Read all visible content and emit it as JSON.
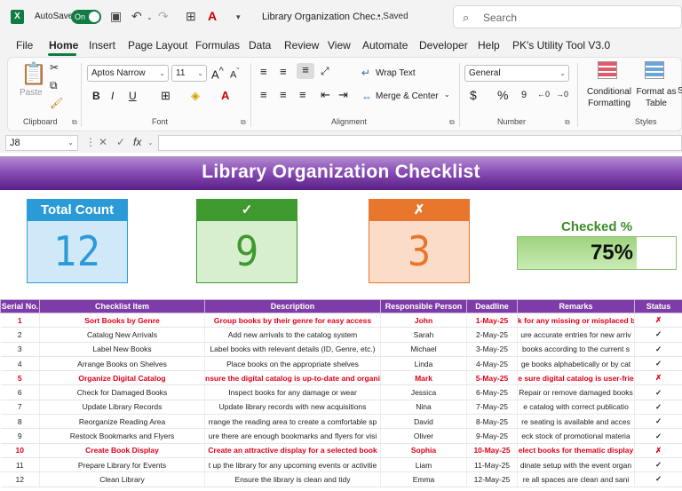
{
  "titlebar": {
    "autosave_label": "AutoSave",
    "toggle_label": "On",
    "doc_title": "Library Organization Chec...",
    "saved_label": "• Saved",
    "search_placeholder": "Search"
  },
  "menu": [
    "File",
    "Home",
    "Insert",
    "Page Layout",
    "Formulas",
    "Data",
    "Review",
    "View",
    "Automate",
    "Developer",
    "Help",
    "PK's Utility Tool V3.0"
  ],
  "ribbon": {
    "clipboard": {
      "paste": "Paste",
      "label": "Clipboard"
    },
    "font": {
      "name": "Aptos Narrow",
      "size": "11",
      "label": "Font",
      "bold": "B",
      "italic": "I",
      "underline": "U"
    },
    "alignment": {
      "wrap": "Wrap Text",
      "merge": "Merge & Center",
      "label": "Alignment"
    },
    "number": {
      "format": "General",
      "label": "Number",
      "currency": "$",
      "percent": "%"
    },
    "styles": {
      "conditional": "Conditional Formatting",
      "format_table": "Format as Table",
      "label": "Styles"
    }
  },
  "formula_bar": {
    "cell_ref": "J8",
    "fx": "fx",
    "value": ""
  },
  "sheet": {
    "title": "Library Organization Checklist",
    "cards": {
      "total": {
        "label": "Total Count",
        "value": "12",
        "color": "#2b9bd8"
      },
      "checked": {
        "label": "✓",
        "value": "9",
        "color": "#3e9a2e"
      },
      "crossed": {
        "label": "✗",
        "value": "3",
        "color": "#e8762c"
      }
    },
    "progress": {
      "label": "Checked %",
      "value_text": "75%",
      "fraction": 0.75
    },
    "columns": [
      "Serial No.",
      "Checklist Item",
      "Description",
      "Responsible Person",
      "Deadline",
      "Remarks",
      "Status"
    ],
    "rows": [
      {
        "no": "1",
        "item": "Sort Books by Genre",
        "desc": "Group books by their genre for easy access",
        "person": "John",
        "deadline": "1-May-25",
        "remarks": "k for any missing or misplaced b",
        "status": "✗",
        "flag": true
      },
      {
        "no": "2",
        "item": "Catalog New Arrivals",
        "desc": "Add new arrivals to the catalog system",
        "person": "Sarah",
        "deadline": "2-May-25",
        "remarks": "ure accurate entries for new arriv",
        "status": "✓",
        "flag": false
      },
      {
        "no": "3",
        "item": "Label New Books",
        "desc": "Label books with relevant details (ID, Genre, etc.)",
        "person": "Michael",
        "deadline": "3-May-25",
        "remarks": "books according to the current s",
        "status": "✓",
        "flag": false
      },
      {
        "no": "4",
        "item": "Arrange Books on Shelves",
        "desc": "Place books on the appropriate shelves",
        "person": "Linda",
        "deadline": "4-May-25",
        "remarks": "ge books alphabetically or by cat",
        "status": "✓",
        "flag": false
      },
      {
        "no": "5",
        "item": "Organize Digital Catalog",
        "desc": "nsure the digital catalog is up-to-date and organiz",
        "person": "Mark",
        "deadline": "5-May-25",
        "remarks": "e sure digital catalog is user-frie",
        "status": "✗",
        "flag": true
      },
      {
        "no": "6",
        "item": "Check for Damaged Books",
        "desc": "Inspect books for any damage or wear",
        "person": "Jessica",
        "deadline": "6-May-25",
        "remarks": "Repair or remove damaged books",
        "status": "✓",
        "flag": false
      },
      {
        "no": "7",
        "item": "Update Library Records",
        "desc": "Update library records with new acquisitions",
        "person": "Nina",
        "deadline": "7-May-25",
        "remarks": "e catalog with correct publicatio",
        "status": "✓",
        "flag": false
      },
      {
        "no": "8",
        "item": "Reorganize Reading Area",
        "desc": "rrange the reading area to create a comfortable sp",
        "person": "David",
        "deadline": "8-May-25",
        "remarks": "re seating is available and acces",
        "status": "✓",
        "flag": false
      },
      {
        "no": "9",
        "item": "Restock Bookmarks and Flyers",
        "desc": "ure there are enough bookmarks and flyers for visi",
        "person": "Oliver",
        "deadline": "9-May-25",
        "remarks": "eck stock of promotional materia",
        "status": "✓",
        "flag": false
      },
      {
        "no": "10",
        "item": "Create Book Display",
        "desc": "Create an attractive display for a selected book",
        "person": "Sophia",
        "deadline": "10-May-25",
        "remarks": "elect books for thematic display",
        "status": "✗",
        "flag": true
      },
      {
        "no": "11",
        "item": "Prepare Library for Events",
        "desc": "t up the library for any upcoming events or activitie",
        "person": "Liam",
        "deadline": "11-May-25",
        "remarks": "dinate setup with the event organ",
        "status": "✓",
        "flag": false
      },
      {
        "no": "12",
        "item": "Clean Library",
        "desc": "Ensure the library is clean and tidy",
        "person": "Emma",
        "deadline": "12-May-25",
        "remarks": "re all spaces are clean and sani",
        "status": "✓",
        "flag": false
      }
    ]
  }
}
